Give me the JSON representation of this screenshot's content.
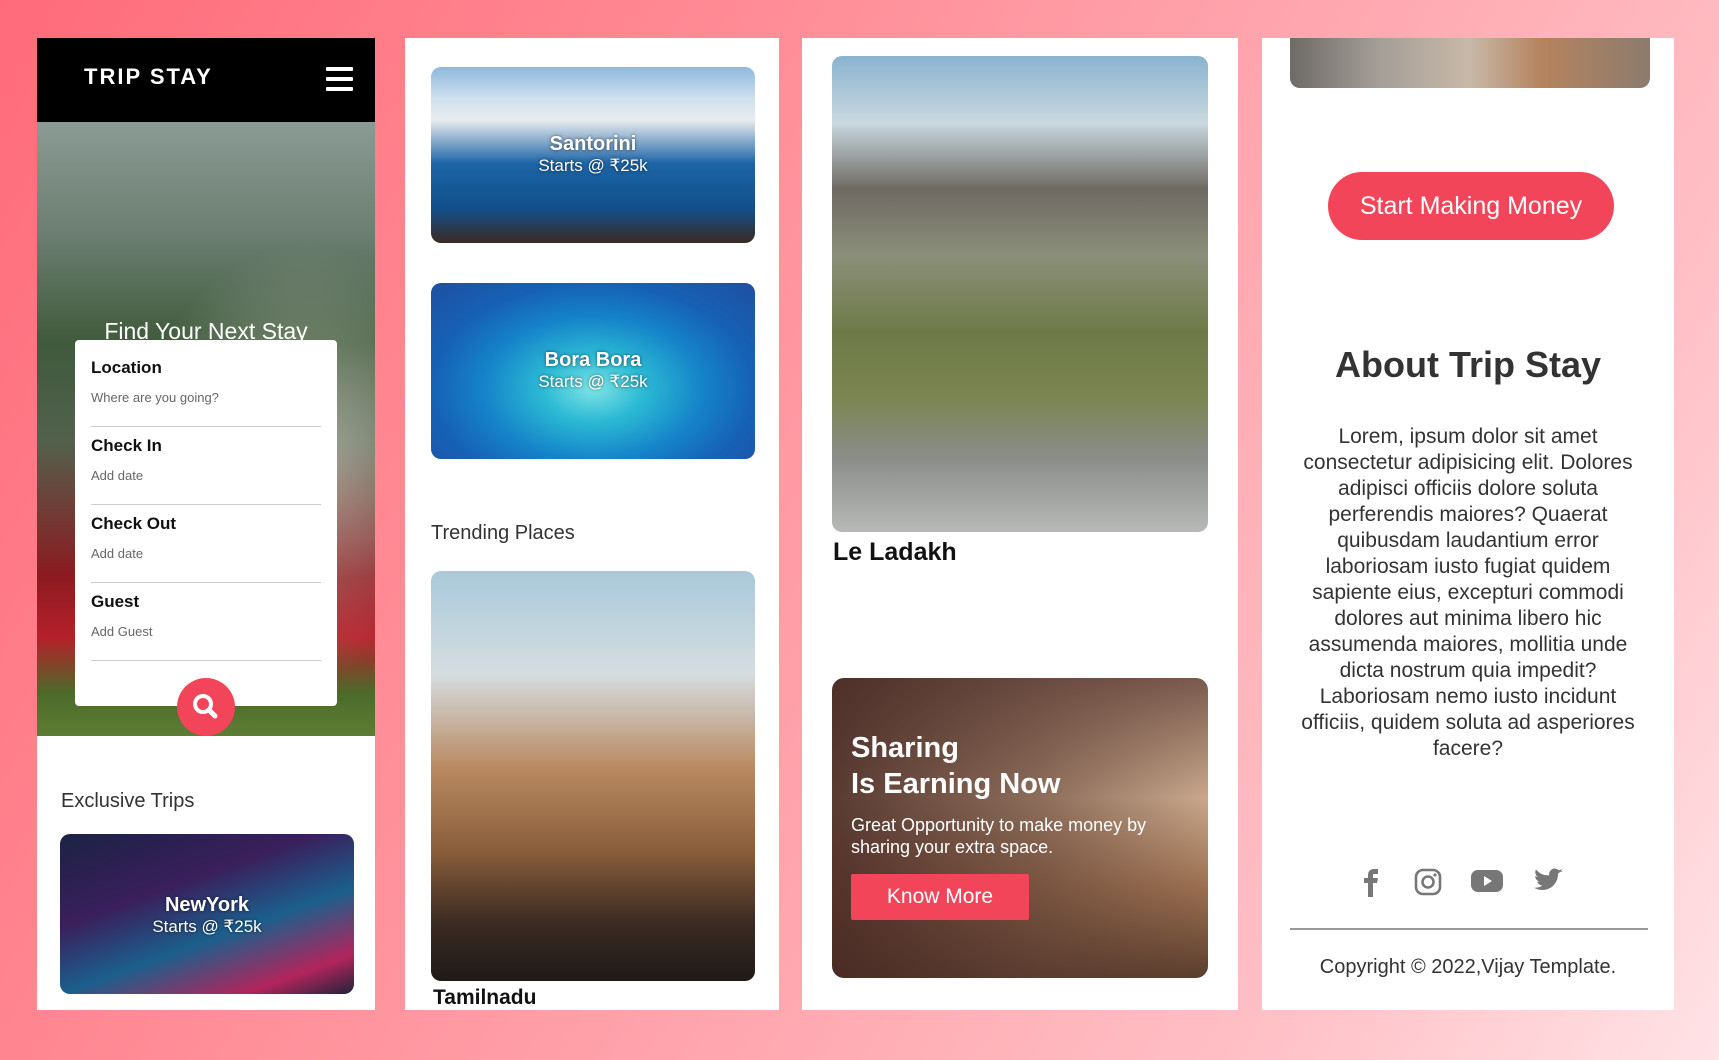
{
  "header": {
    "brand": "TRIP STAY",
    "menu_icon": "hamburger-menu-icon"
  },
  "hero": {
    "title": "Find Your Next Stay"
  },
  "search_form": {
    "fields": [
      {
        "label": "Location",
        "placeholder": "Where are you going?"
      },
      {
        "label": "Check In",
        "placeholder": "Add date"
      },
      {
        "label": "Check Out",
        "placeholder": "Add date"
      },
      {
        "label": "Guest",
        "placeholder": "Add Guest"
      }
    ],
    "search_icon": "search-icon"
  },
  "exclusive": {
    "title": "Exclusive Trips",
    "cards": [
      {
        "name": "NewYork",
        "price": "Starts @ ₹25k"
      },
      {
        "name": "Santorini",
        "price": "Starts @ ₹25k"
      },
      {
        "name": "Bora Bora",
        "price": "Starts @ ₹25k"
      }
    ]
  },
  "trending": {
    "title": "Trending Places",
    "places": [
      {
        "name": "Tamilnadu"
      },
      {
        "name": "Le Ladakh"
      }
    ]
  },
  "earning": {
    "title_line1": "Sharing",
    "title_line2": "Is Earning Now",
    "text": "Great Opportunity to make money by sharing your extra space.",
    "button": "Know More"
  },
  "cta": {
    "button": "Start Making Money"
  },
  "about": {
    "title": "About Trip Stay",
    "text": "Lorem, ipsum dolor sit amet consectetur adipisicing elit. Dolores adipisci officiis dolore soluta perferendis maiores? Quaerat quibusdam laudantium error laboriosam iusto fugiat quidem sapiente eius, excepturi commodi dolores aut minima libero hic assumenda maiores, mollitia unde dicta nostrum quia impedit? Laboriosam nemo iusto incidunt officiis, quidem soluta ad asperiores facere?"
  },
  "footer": {
    "social_icons": [
      "facebook-icon",
      "instagram-icon",
      "youtube-icon",
      "twitter-icon"
    ],
    "copyright": "Copyright © 2022,Vijay Template."
  },
  "colors": {
    "accent": "#f2455a",
    "nav_bg": "#000000"
  }
}
